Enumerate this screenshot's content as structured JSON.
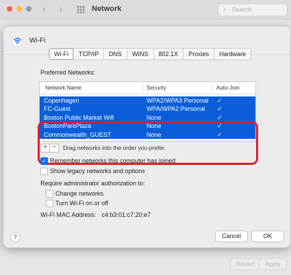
{
  "background": {
    "title": "Network",
    "search_placeholder": "Search",
    "revert_label": "Revert",
    "apply_label": "Apply"
  },
  "sheet": {
    "title": "Wi-Fi",
    "tabs": [
      {
        "label": "Wi-Fi",
        "active": true
      },
      {
        "label": "TCP/IP"
      },
      {
        "label": "DNS"
      },
      {
        "label": "WINS"
      },
      {
        "label": "802.1X"
      },
      {
        "label": "Proxies"
      },
      {
        "label": "Hardware"
      }
    ],
    "preferred_label": "Preferred Networks:",
    "table": {
      "headers": [
        "Network Name",
        "Security",
        "Auto-Join"
      ],
      "rows": [
        {
          "name": "Copenhagen",
          "security": "WPA2/WPA3 Personal",
          "auto_join": "✓"
        },
        {
          "name": "FC-Guest",
          "security": "WPA/WPA2 Personal",
          "auto_join": "✓"
        },
        {
          "name": "Boston Public Market Wifi",
          "security": "None",
          "auto_join": "✓"
        },
        {
          "name": "BostonParkPlaza",
          "security": "None",
          "auto_join": "✓"
        },
        {
          "name": "Commonwealth_GUEST",
          "security": "None",
          "auto_join": "✓"
        }
      ]
    },
    "plus": "+",
    "minus": "−",
    "drag_hint": "Drag networks into the order you prefer.",
    "remember_label": "Remember networks this computer has joined",
    "legacy_label": "Show legacy networks and options",
    "require_label": "Require administrator authorization to:",
    "change_networks_label": "Change networks",
    "turn_wifi_label": "Turn Wi-Fi on or off",
    "mac_label": "Wi-Fi MAC Address:",
    "mac_value": "c4:b3:01:c7:20:e7",
    "help": "?",
    "cancel_label": "Cancel",
    "ok_label": "OK"
  },
  "colors": {
    "selection": "#0b5ed7",
    "highlight_ring": "#e11d2a"
  }
}
